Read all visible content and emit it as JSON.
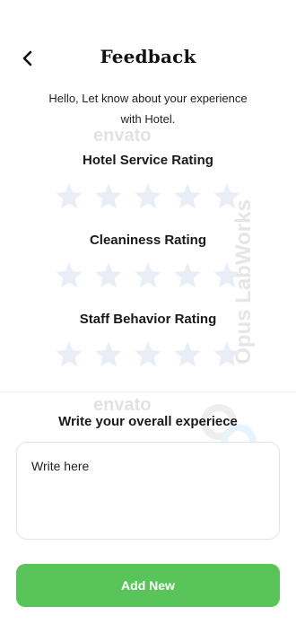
{
  "header": {
    "title": "Feedback",
    "back_icon": "chevron-left-icon"
  },
  "intro": {
    "line1": "Hello, Let know about your experience",
    "line2": "with Hotel."
  },
  "ratings": [
    {
      "label": "Hotel Service Rating",
      "value": 0,
      "max": 5
    },
    {
      "label": "Cleaniness Rating",
      "value": 0,
      "max": 5
    },
    {
      "label": "Staff Behavior Rating",
      "value": 0,
      "max": 5
    }
  ],
  "review": {
    "label": "Write your overall experiece",
    "placeholder": "Write here",
    "value": ""
  },
  "submit": {
    "label": "Add New"
  },
  "watermarks": {
    "envato": "envato",
    "opus": "Opus LabWorks"
  },
  "colors": {
    "primary_button": "#59c45a",
    "star_empty": "#e9eef6",
    "text_dark": "#111111"
  }
}
